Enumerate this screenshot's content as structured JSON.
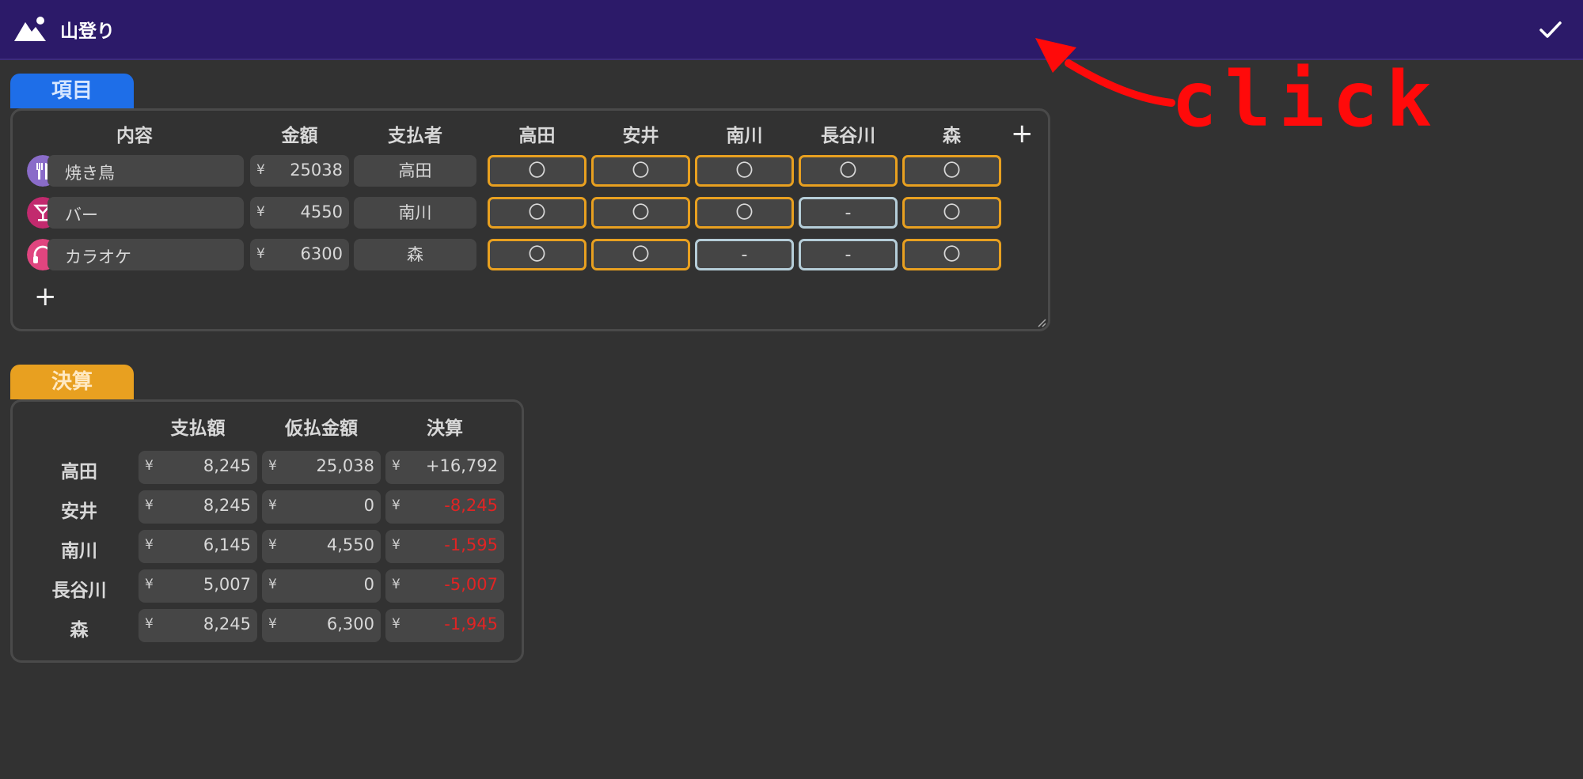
{
  "app": {
    "title": "山登り",
    "icon": "mountain-icon",
    "confirm_icon": "check-icon"
  },
  "annotation": {
    "text": "click",
    "color": "#ff0a0a"
  },
  "items_section": {
    "tab_label": "項目",
    "columns": [
      "内容",
      "金額",
      "支払者",
      "高田",
      "安井",
      "南川",
      "長谷川",
      "森"
    ],
    "currency": "¥",
    "rows": [
      {
        "icon": "fork-knife-icon",
        "icon_color": "#8a6cc9",
        "name": "焼き鳥",
        "amount": "25038",
        "payer": "高田",
        "shares": [
          "〇",
          "〇",
          "〇",
          "〇",
          "〇"
        ]
      },
      {
        "icon": "cocktail-icon",
        "icon_color": "#c22a6e",
        "name": "バー",
        "amount": "4550",
        "payer": "南川",
        "shares": [
          "〇",
          "〇",
          "〇",
          "-",
          "〇"
        ]
      },
      {
        "icon": "headphones-icon",
        "icon_color": "#e0457f",
        "name": "カラオケ",
        "amount": "6300",
        "payer": "森",
        "shares": [
          "〇",
          "〇",
          "-",
          "-",
          "〇"
        ]
      }
    ],
    "add_row_label": "+",
    "add_column_label": "+"
  },
  "settle_section": {
    "tab_label": "決算",
    "columns": [
      "支払額",
      "仮払金額",
      "決算"
    ],
    "currency": "¥",
    "rows": [
      {
        "name": "高田",
        "pay": "8,245",
        "advance": "25,038",
        "balance": "+16,792"
      },
      {
        "name": "安井",
        "pay": "8,245",
        "advance": "0",
        "balance": "-8,245"
      },
      {
        "name": "南川",
        "pay": "6,145",
        "advance": "4,550",
        "balance": "-1,595"
      },
      {
        "name": "長谷川",
        "pay": "5,007",
        "advance": "0",
        "balance": "-5,007"
      },
      {
        "name": "森",
        "pay": "8,245",
        "advance": "6,300",
        "balance": "-1,945"
      }
    ]
  },
  "colors": {
    "header": "#2c1a69",
    "items_tab": "#1e6ee8",
    "settle_tab": "#e8a020",
    "share_on": "#e8a020",
    "share_off": "#b5cdd8",
    "negative": "#e02424"
  }
}
